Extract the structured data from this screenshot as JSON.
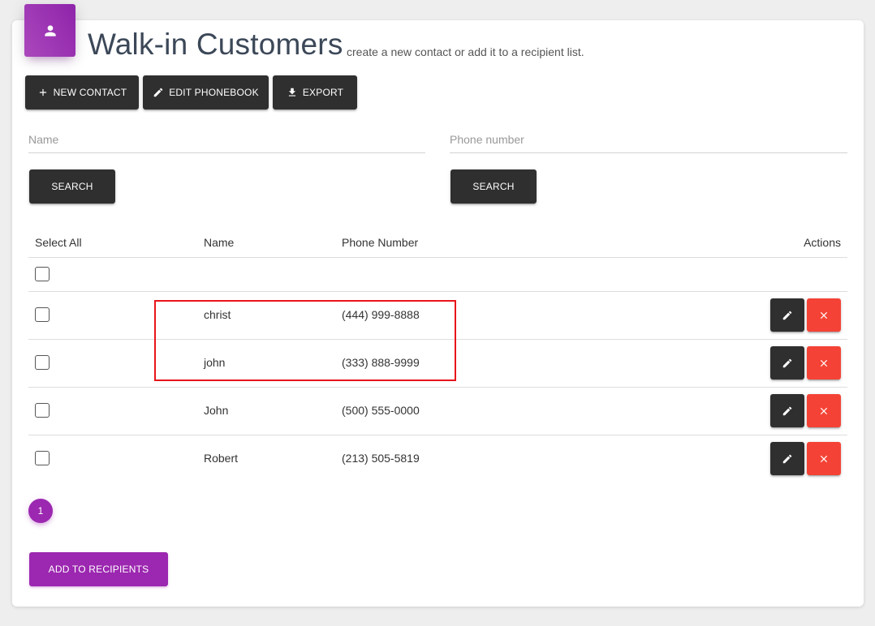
{
  "header": {
    "title": "Walk-in Customers",
    "subtitle": "create a new contact or add it to a recipient list.",
    "accent_color": "#9c27b0",
    "icon": "person-icon"
  },
  "toolbar": {
    "new_contact_label": "NEW CONTACT",
    "edit_phonebook_label": "EDIT PHONEBOOK",
    "export_label": "EXPORT"
  },
  "search": {
    "name_placeholder": "Name",
    "name_value": "",
    "phone_placeholder": "Phone number",
    "phone_value": "",
    "search_label": "SEARCH"
  },
  "table": {
    "headers": {
      "select_all": "Select All",
      "name": "Name",
      "phone": "Phone Number",
      "actions": "Actions"
    },
    "rows": [
      {
        "name": "christ",
        "phone": "(444) 999-8888"
      },
      {
        "name": "john",
        "phone": "(333) 888-9999"
      },
      {
        "name": "John",
        "phone": "(500) 555-0000"
      },
      {
        "name": "Robert",
        "phone": "(213) 505-5819"
      }
    ]
  },
  "pagination": {
    "current_page": "1"
  },
  "footer": {
    "add_to_recipients_label": "ADD TO RECIPIENTS"
  },
  "colors": {
    "dark_button": "#2f2f2f",
    "delete_button": "#f44336",
    "highlight_box": "#e8141a"
  }
}
